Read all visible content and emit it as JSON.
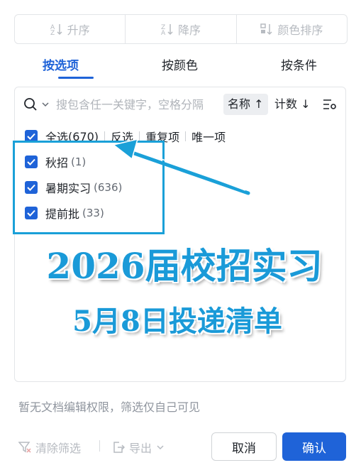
{
  "sort_bar": {
    "ascending": "升序",
    "descending": "降序",
    "color_sort": "颜色排序"
  },
  "tabs": [
    {
      "label": "按选项",
      "active": true
    },
    {
      "label": "按颜色",
      "active": false
    },
    {
      "label": "按条件",
      "active": false
    }
  ],
  "search": {
    "placeholder": "搜包含任一关键字，空格分隔",
    "sort_name": "名称 ↑",
    "sort_count": "计数 ↓"
  },
  "options_header": {
    "select_all": "全选",
    "select_all_count": "(670)",
    "invert": "反选",
    "duplicates": "重复项",
    "unique": "唯一项"
  },
  "options": [
    {
      "label": "秋招",
      "count": "(1)",
      "checked": true
    },
    {
      "label": "暑期实习",
      "count": "(636)",
      "checked": true
    },
    {
      "label": "提前批",
      "count": "(33)",
      "checked": true
    }
  ],
  "overlay": {
    "line1": "2026届校招实习",
    "line2": "5月8日投递清单"
  },
  "notice": "暂无文档编辑权限，筛选仅自己可见",
  "footer": {
    "clear_filter": "清除筛选",
    "export": "导出",
    "cancel": "取消",
    "confirm": "确认"
  },
  "colors": {
    "accent": "#1f63d8",
    "annotation": "#1aa0d8"
  }
}
